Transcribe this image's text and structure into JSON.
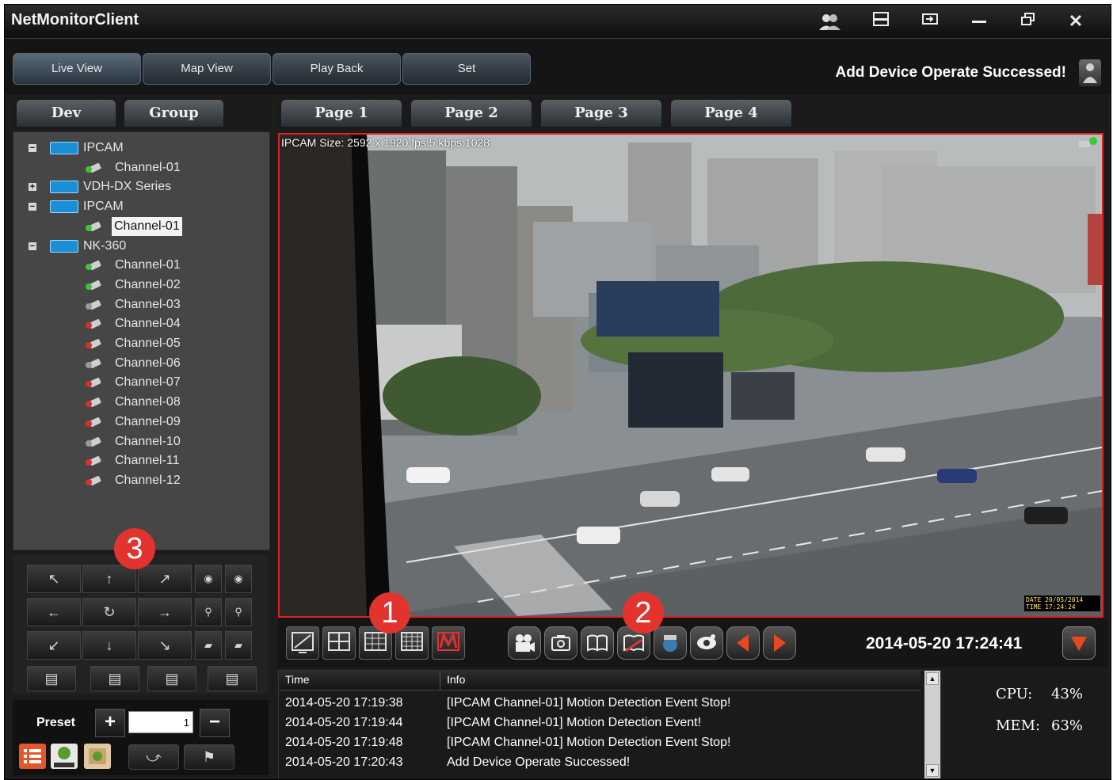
{
  "app": {
    "title": "NetMonitorClient"
  },
  "window_controls": [
    "users-icon",
    "minimize-to-bar-icon",
    "restore-icon",
    "minimize-icon",
    "maximize-icon",
    "close-icon"
  ],
  "nav": {
    "tabs": [
      {
        "label": "Live View",
        "active": true
      },
      {
        "label": "Map View",
        "active": false
      },
      {
        "label": "Play Back",
        "active": false
      },
      {
        "label": "Set",
        "active": false
      }
    ],
    "status_message": "Add Device Operate Successed!"
  },
  "side_tabs": [
    {
      "label": "Dev"
    },
    {
      "label": "Group"
    }
  ],
  "tree": [
    {
      "label": "IPCAM",
      "kind": "device",
      "expanded": true
    },
    {
      "label": "Channel-01",
      "kind": "channel",
      "status": "online"
    },
    {
      "label": "VDH-DX Series",
      "kind": "device",
      "expanded": false
    },
    {
      "label": "IPCAM",
      "kind": "device",
      "expanded": true
    },
    {
      "label": "Channel-01",
      "kind": "channel",
      "status": "online",
      "selected": true
    },
    {
      "label": "NK-360",
      "kind": "device",
      "expanded": true
    },
    {
      "label": "Channel-01",
      "kind": "channel",
      "status": "online"
    },
    {
      "label": "Channel-02",
      "kind": "channel",
      "status": "online"
    },
    {
      "label": "Channel-03",
      "kind": "channel",
      "status": "idle"
    },
    {
      "label": "Channel-04",
      "kind": "channel",
      "status": "offline"
    },
    {
      "label": "Channel-05",
      "kind": "channel",
      "status": "offline"
    },
    {
      "label": "Channel-06",
      "kind": "channel",
      "status": "idle"
    },
    {
      "label": "Channel-07",
      "kind": "channel",
      "status": "offline"
    },
    {
      "label": "Channel-08",
      "kind": "channel",
      "status": "offline"
    },
    {
      "label": "Channel-09",
      "kind": "channel",
      "status": "offline"
    },
    {
      "label": "Channel-10",
      "kind": "channel",
      "status": "idle"
    },
    {
      "label": "Channel-11",
      "kind": "channel",
      "status": "offline"
    },
    {
      "label": "Channel-12",
      "kind": "channel",
      "status": "offline"
    }
  ],
  "ptz": {
    "directions": [
      "↖",
      "↑",
      "↗",
      "←",
      "↻",
      "→",
      "↙",
      "↓",
      "↘"
    ],
    "preset_label": "Preset",
    "preset_value": "1"
  },
  "pages": [
    {
      "label": "Page 1"
    },
    {
      "label": "Page 2"
    },
    {
      "label": "Page 3"
    },
    {
      "label": "Page 4"
    }
  ],
  "video": {
    "caption": "IPCAM Size: 2592 x 1920 fps:5 kbps:1028",
    "overlay_timestamp": "DATE 20/05/2014 TIME 17:24:24"
  },
  "toolbar": {
    "clock": "2014-05-20 17:24:41"
  },
  "annotations": {
    "badge_1": "1",
    "badge_2": "2",
    "badge_3": "3"
  },
  "log": {
    "columns": [
      "Time",
      "Info"
    ],
    "rows": [
      {
        "time": "2014-05-20 17:19:38",
        "info": "[IPCAM Channel-01] Motion Detection Event Stop!"
      },
      {
        "time": "2014-05-20 17:19:44",
        "info": "[IPCAM Channel-01] Motion Detection Event!"
      },
      {
        "time": "2014-05-20 17:19:48",
        "info": "[IPCAM Channel-01] Motion Detection Event Stop!"
      },
      {
        "time": "2014-05-20 17:20:43",
        "info": "Add Device Operate Successed!"
      }
    ]
  },
  "stats": {
    "cpu_label": "CPU:",
    "cpu_value": "43%",
    "mem_label": "MEM:",
    "mem_value": "63%"
  },
  "colors": {
    "accent_red": "#d22222",
    "badge_red": "#e3332e",
    "device_blue": "#1b8fd6"
  }
}
